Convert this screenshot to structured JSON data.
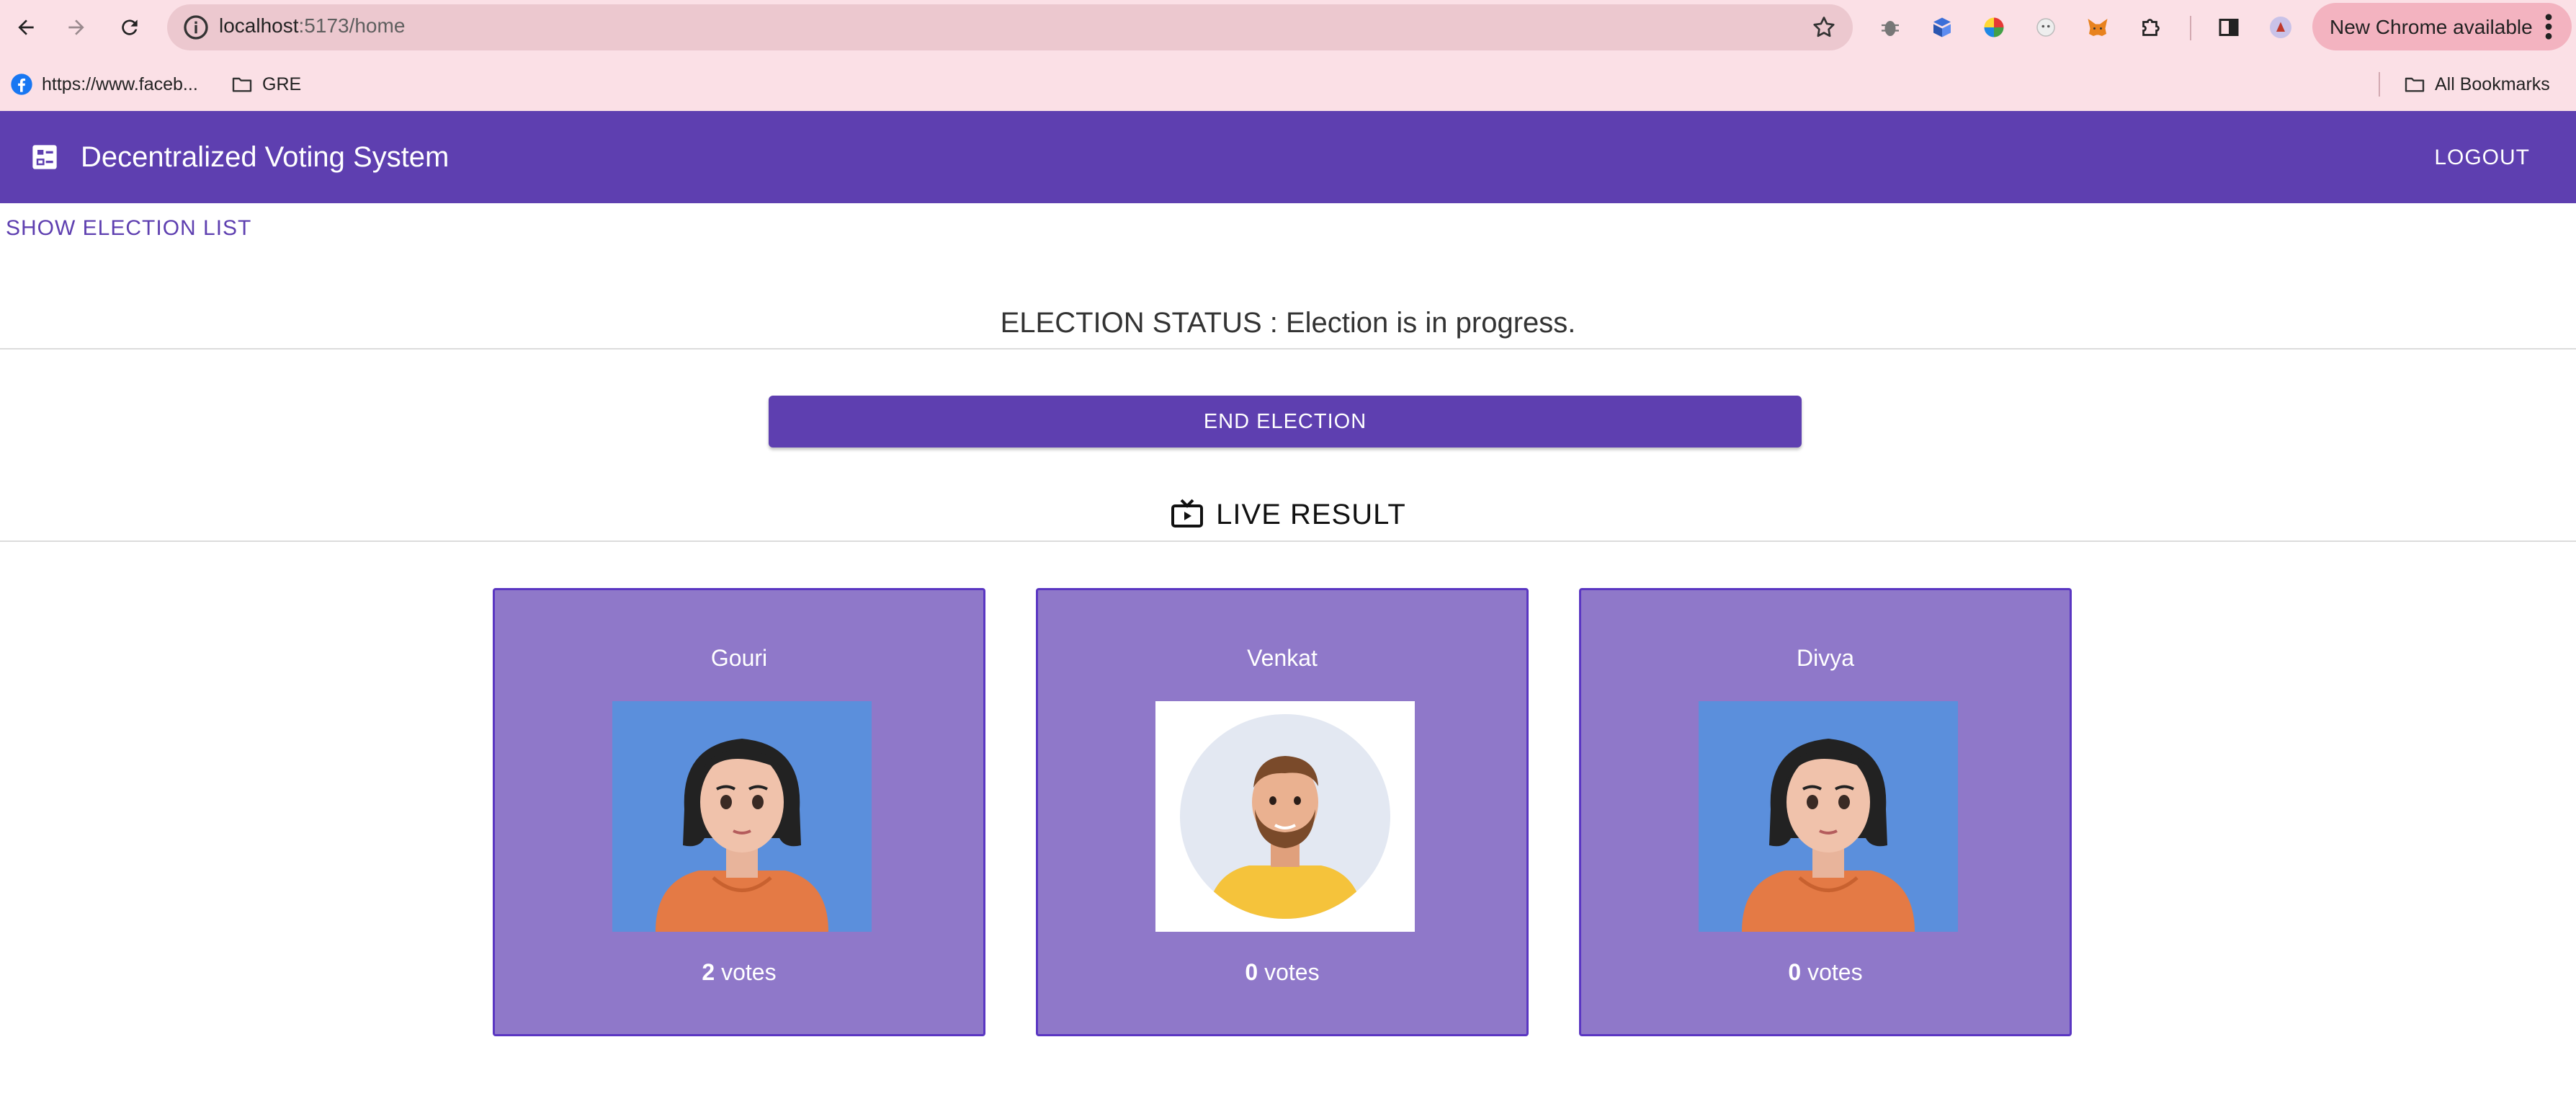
{
  "browser": {
    "url_host": "localhost",
    "url_path": ":5173/home",
    "new_chrome_label": "New Chrome available",
    "bookmarks": [
      {
        "label": "https://www.faceb...",
        "icon": "facebook-icon"
      },
      {
        "label": "GRE",
        "icon": "folder-icon"
      }
    ],
    "all_bookmarks_label": "All Bookmarks"
  },
  "appbar": {
    "title": "Decentralized Voting System",
    "logout_label": "LOGOUT",
    "brand_color": "#5e3fb0"
  },
  "show_election_list_label": "SHOW ELECTION LIST",
  "election_status": "ELECTION STATUS : Election is in progress.",
  "end_election_label": "END ELECTION",
  "live_result": {
    "title": "LIVE RESULT",
    "icon": "live-tv-icon"
  },
  "candidates": [
    {
      "name": "Gouri",
      "votes": "2",
      "votes_suffix": " votes",
      "avatar": "female-avatar"
    },
    {
      "name": "Venkat",
      "votes": "0",
      "votes_suffix": " votes",
      "avatar": "male-avatar"
    },
    {
      "name": "Divya",
      "votes": "0",
      "votes_suffix": " votes",
      "avatar": "female-avatar"
    }
  ],
  "colors": {
    "card_background": "#8f78c9",
    "card_border": "#5a36c2",
    "chrome_background": "#fbe0e6"
  }
}
